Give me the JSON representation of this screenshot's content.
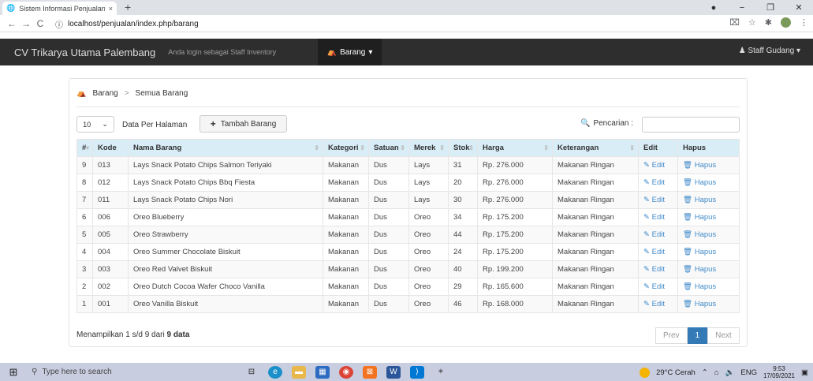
{
  "browser": {
    "tab_title": "Sistem Informasi Penjualan CV Tr",
    "tab_close": "×",
    "new_tab": "+",
    "url": "localhost/penjualan/index.php/barang"
  },
  "app": {
    "brand": "CV Trikarya Utama Palembang",
    "login_info": "Anda login sebagai Staff Inventory",
    "menu_active": "Barang",
    "user_menu": "Staff Gudang"
  },
  "breadcrumb": {
    "items": [
      "Barang",
      "Semua Barang"
    ],
    "separator": ">"
  },
  "controls": {
    "per_page_value": "10",
    "per_page_label": "Data Per Halaman",
    "add_button": "Tambah Barang",
    "search_label": "Pencarian :",
    "search_value": ""
  },
  "table": {
    "headers": [
      "#",
      "Kode",
      "Nama Barang",
      "Kategori",
      "Satuan",
      "Merek",
      "Stok",
      "Harga",
      "Keterangan",
      "Edit",
      "Hapus"
    ],
    "edit_label": "Edit",
    "hapus_label": "Hapus",
    "rows": [
      {
        "no": "9",
        "kode": "013",
        "nama": "Lays Snack Potato Chips Salmon Teriyaki",
        "kategori": "Makanan",
        "satuan": "Dus",
        "merek": "Lays",
        "stok": "31",
        "harga": "Rp. 276.000",
        "keterangan": "Makanan Ringan"
      },
      {
        "no": "8",
        "kode": "012",
        "nama": "Lays Snack Potato Chips Bbq Fiesta",
        "kategori": "Makanan",
        "satuan": "Dus",
        "merek": "Lays",
        "stok": "20",
        "harga": "Rp. 276.000",
        "keterangan": "Makanan Ringan"
      },
      {
        "no": "7",
        "kode": "011",
        "nama": "Lays Snack Potato Chips Nori",
        "kategori": "Makanan",
        "satuan": "Dus",
        "merek": "Lays",
        "stok": "30",
        "harga": "Rp. 276.000",
        "keterangan": "Makanan Ringan"
      },
      {
        "no": "6",
        "kode": "006",
        "nama": "Oreo Blueberry",
        "kategori": "Makanan",
        "satuan": "Dus",
        "merek": "Oreo",
        "stok": "34",
        "harga": "Rp. 175.200",
        "keterangan": "Makanan Ringan"
      },
      {
        "no": "5",
        "kode": "005",
        "nama": "Oreo Strawberry",
        "kategori": "Makanan",
        "satuan": "Dus",
        "merek": "Oreo",
        "stok": "44",
        "harga": "Rp. 175.200",
        "keterangan": "Makanan Ringan"
      },
      {
        "no": "4",
        "kode": "004",
        "nama": "Oreo Summer Chocolate Biskuit",
        "kategori": "Makanan",
        "satuan": "Dus",
        "merek": "Oreo",
        "stok": "24",
        "harga": "Rp. 175.200",
        "keterangan": "Makanan Ringan"
      },
      {
        "no": "3",
        "kode": "003",
        "nama": "Oreo Red Valvet Biskuit",
        "kategori": "Makanan",
        "satuan": "Dus",
        "merek": "Oreo",
        "stok": "40",
        "harga": "Rp. 199.200",
        "keterangan": "Makanan Ringan"
      },
      {
        "no": "2",
        "kode": "002",
        "nama": "Oreo Dutch Cocoa Wafer Choco Vanilla",
        "kategori": "Makanan",
        "satuan": "Dus",
        "merek": "Oreo",
        "stok": "29",
        "harga": "Rp. 165.600",
        "keterangan": "Makanan Ringan"
      },
      {
        "no": "1",
        "kode": "001",
        "nama": "Oreo Vanilla Biskuit",
        "kategori": "Makanan",
        "satuan": "Dus",
        "merek": "Oreo",
        "stok": "46",
        "harga": "Rp. 168.000",
        "keterangan": "Makanan Ringan"
      }
    ]
  },
  "footer": {
    "info_prefix": "Menampilkan 1 s/d 9 dari",
    "info_bold": "9 data",
    "prev": "Prev",
    "current_page": "1",
    "next": "Next"
  },
  "taskbar": {
    "search_placeholder": "Type here to search",
    "weather": "29°C  Cerah",
    "lang": "ENG",
    "time": "9:53",
    "date": "17/09/2021"
  },
  "colors": {
    "navbar_bg": "#2e2e2e",
    "table_header_bg": "#d9edf7",
    "link": "#428bca",
    "pager_active": "#337ab7"
  }
}
